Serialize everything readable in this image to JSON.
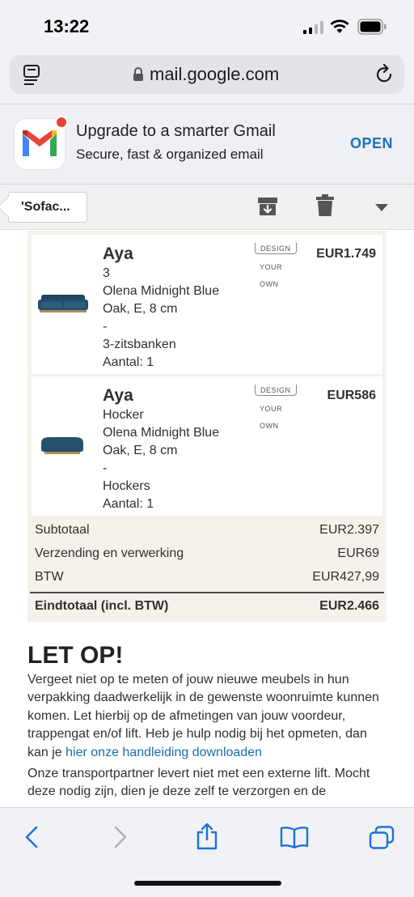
{
  "status_bar": {
    "time": "13:22"
  },
  "browser": {
    "host": "mail.google.com"
  },
  "banner": {
    "title": "Upgrade to a smarter Gmail",
    "subtitle": "Secure, fast & organized email",
    "open_label": "OPEN"
  },
  "toolbar": {
    "back_label": "'Sofac..."
  },
  "items": [
    {
      "name": "Aya",
      "lines": [
        "3",
        "Olena Midnight Blue",
        "Oak, E, 8 cm",
        "-",
        "3-zitsbanken",
        "Aantal: 1"
      ],
      "badge": [
        "DESIGN",
        "YOUR",
        "OWN"
      ],
      "price": "EUR1.749"
    },
    {
      "name": "Aya",
      "lines": [
        "Hocker",
        "Olena Midnight Blue",
        "Oak, E, 8 cm",
        "-",
        "Hockers",
        "Aantal: 1"
      ],
      "badge": [
        "DESIGN",
        "YOUR",
        "OWN"
      ],
      "price": "EUR586"
    }
  ],
  "summary": [
    {
      "label": "Subtotaal",
      "value": "EUR2.397"
    },
    {
      "label": "Verzending en verwerking",
      "value": "EUR69"
    },
    {
      "label": "BTW",
      "value": "EUR427,99"
    }
  ],
  "total": {
    "label": "Eindtotaal (incl. BTW)",
    "value": "EUR2.466"
  },
  "notice": {
    "heading": "LET OP!",
    "para1": "Vergeet niet op te meten of jouw nieuwe meubels in hun verpakking daadwerkelijk in de gewenste woonruimte kunnen komen. Let hierbij op de afmetingen van jouw voordeur, trappengat en/of lift. Heb je hulp nodig bij het opmeten, dan kan je ",
    "para1_link": "hier onze handleiding downloaden",
    "para2": "Onze transportpartner levert niet met een externe lift. Mocht deze nodig zijn, dien je deze zelf te verzorgen en de"
  },
  "colors": {
    "link": "#1a73b8",
    "card_bg": "#f5f2ec",
    "sofa": "#24506a"
  }
}
